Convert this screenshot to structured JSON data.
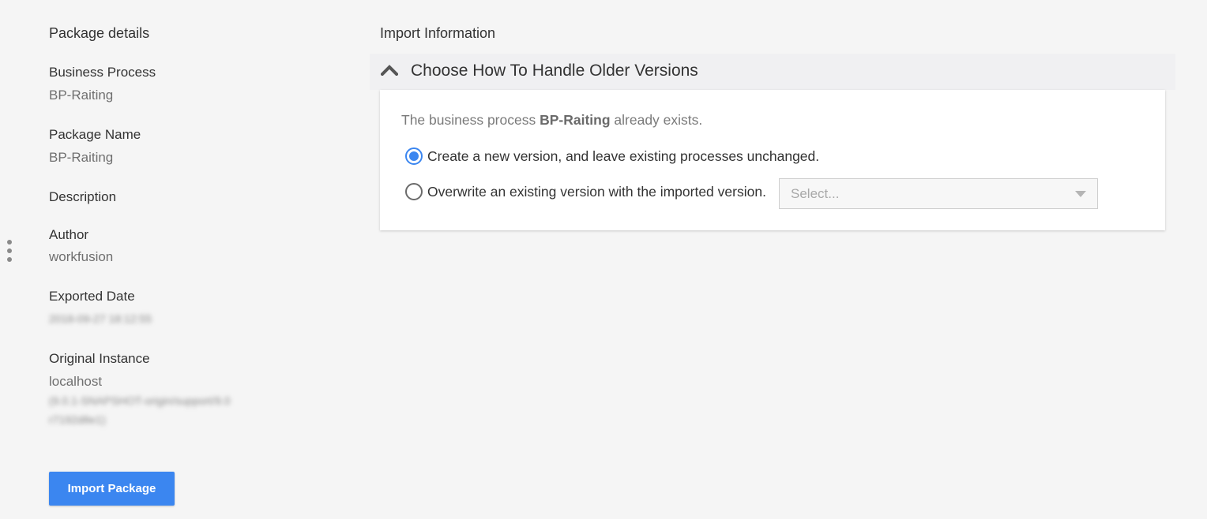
{
  "package_details": {
    "title": "Package details",
    "fields": [
      {
        "label": "Business Process",
        "value": "BP-Raiting"
      },
      {
        "label": "Package Name",
        "value": "BP-Raiting"
      },
      {
        "label": "Description",
        "value": ""
      },
      {
        "label": "Author",
        "value": "workfusion"
      },
      {
        "label": "Exported Date",
        "value": "2018-09-27 18:12:55"
      },
      {
        "label": "Original Instance",
        "value": "localhost",
        "extra_line_1": "(9.0.1-SNAPSHOT-origin/support/9.0",
        "extra_line_2": "r7192d8e1)"
      }
    ],
    "import_button_label": "Import Package"
  },
  "import_information": {
    "title": "Import Information",
    "accordion": {
      "title": "Choose How To Handle Older Versions",
      "expanded": true,
      "info_prefix": "The business process ",
      "info_process": "BP-Raiting",
      "info_suffix": " already exists.",
      "options": [
        {
          "label": "Create a new version, and leave existing processes unchanged.",
          "selected": true
        },
        {
          "label": "Overwrite an existing version with the imported version.",
          "selected": false
        }
      ],
      "select_placeholder": "Select..."
    }
  },
  "colors": {
    "accent": "#3b86f0",
    "background": "#f5f5f5"
  }
}
